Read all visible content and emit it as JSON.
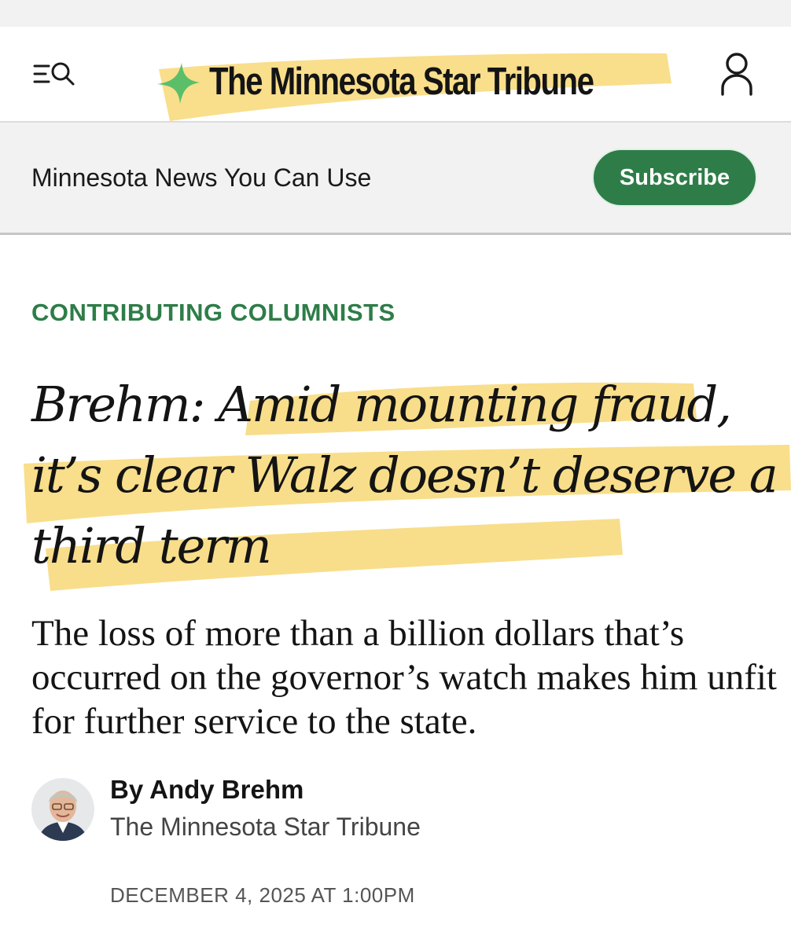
{
  "header": {
    "logo_text": "The Minnesota Star Tribune",
    "menu_icon": "menu-search-icon",
    "account_icon": "user-icon",
    "star_icon": "star-icon"
  },
  "promo": {
    "tagline": "Minnesota News You Can Use",
    "subscribe_label": "Subscribe"
  },
  "article": {
    "section": "CONTRIBUTING COLUMNISTS",
    "headline": "Brehm: Amid mounting fraud, it’s clear Walz doesn’t deserve a third term",
    "dek": "The loss of more than a billion dollars that’s occurred on the governor’s watch makes him unfit for further service to the state.",
    "byline": "By Andy Brehm",
    "outlet": "The Minnesota Star Tribune",
    "date": "DECEMBER 4, 2025 AT 1:00PM"
  },
  "colors": {
    "brand_green": "#2e7d48",
    "highlight": "#f7d66e",
    "star_green": "#5bbf6a"
  }
}
